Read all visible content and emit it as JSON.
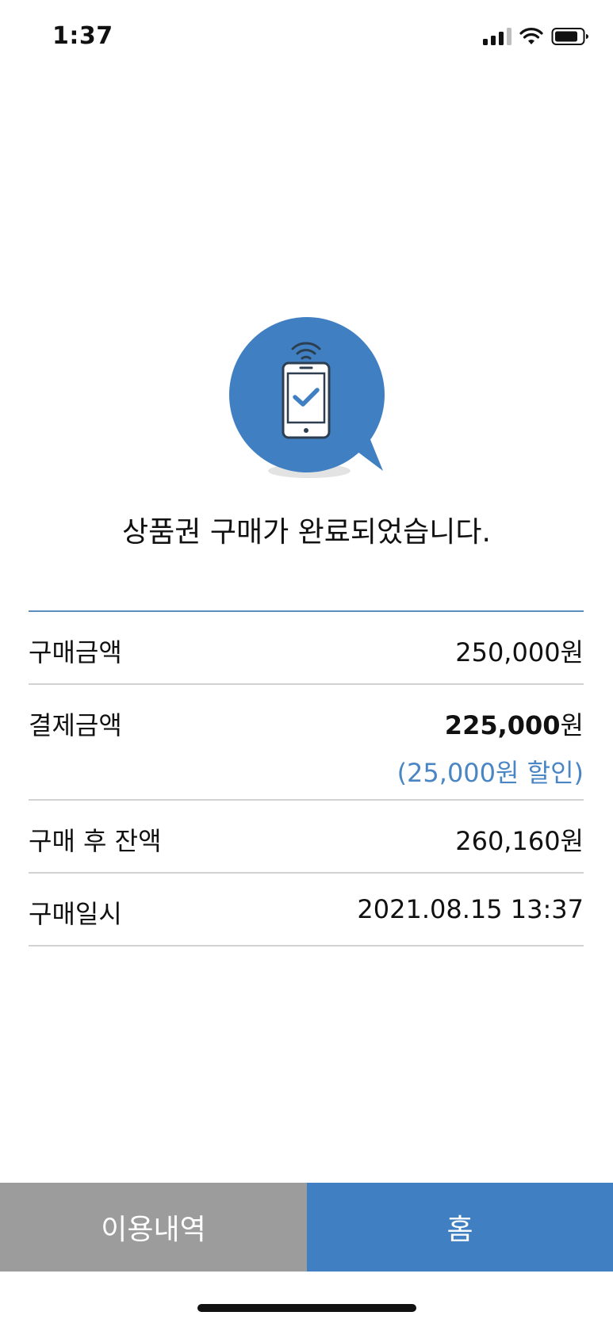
{
  "status_bar": {
    "time": "1:37"
  },
  "hero": {
    "icon": "phone-check-icon",
    "title": "상품권 구매가 완료되었습니다.",
    "icon_color": "#4080c2"
  },
  "summary": {
    "rows": [
      {
        "label": "구매금액",
        "value": "250,000원"
      },
      {
        "label": "결제금액",
        "value_strong": "225,000",
        "value_unit": "원",
        "sub": "(25,000원 할인)"
      },
      {
        "label": "구매 후 잔액",
        "value": "260,160원"
      },
      {
        "label": "구매일시",
        "value": "2021.08.15 13:37"
      }
    ]
  },
  "buttons": {
    "history_label": "이용내역",
    "home_label": "홈"
  },
  "colors": {
    "primary": "#4080c2",
    "secondary_button": "#9c9c9c",
    "discount_text": "#4a86c4"
  }
}
